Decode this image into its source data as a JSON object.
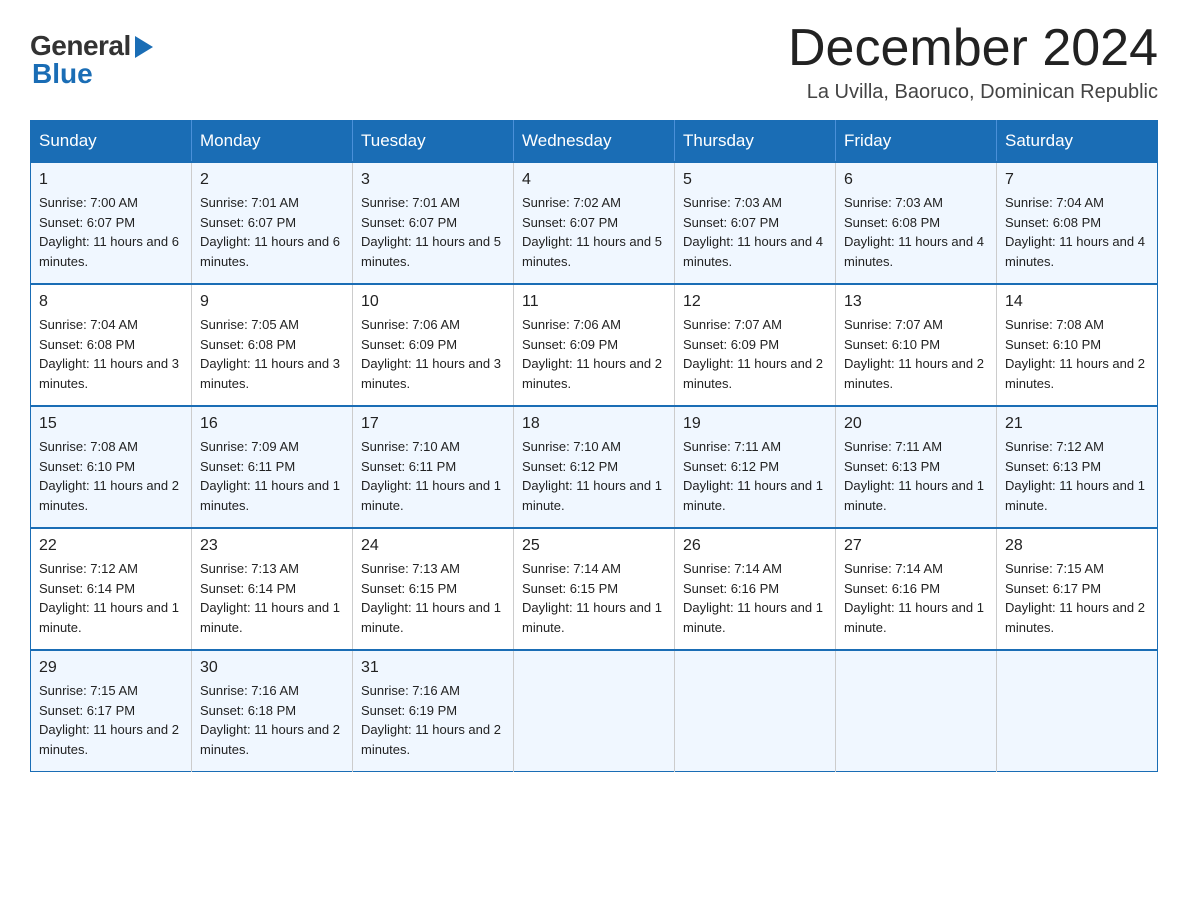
{
  "logo": {
    "general": "General",
    "blue": "Blue"
  },
  "title": "December 2024",
  "location": "La Uvilla, Baoruco, Dominican Republic",
  "days_of_week": [
    "Sunday",
    "Monday",
    "Tuesday",
    "Wednesday",
    "Thursday",
    "Friday",
    "Saturday"
  ],
  "weeks": [
    [
      {
        "day": "1",
        "sunrise": "7:00 AM",
        "sunset": "6:07 PM",
        "daylight": "11 hours and 6 minutes."
      },
      {
        "day": "2",
        "sunrise": "7:01 AM",
        "sunset": "6:07 PM",
        "daylight": "11 hours and 6 minutes."
      },
      {
        "day": "3",
        "sunrise": "7:01 AM",
        "sunset": "6:07 PM",
        "daylight": "11 hours and 5 minutes."
      },
      {
        "day": "4",
        "sunrise": "7:02 AM",
        "sunset": "6:07 PM",
        "daylight": "11 hours and 5 minutes."
      },
      {
        "day": "5",
        "sunrise": "7:03 AM",
        "sunset": "6:07 PM",
        "daylight": "11 hours and 4 minutes."
      },
      {
        "day": "6",
        "sunrise": "7:03 AM",
        "sunset": "6:08 PM",
        "daylight": "11 hours and 4 minutes."
      },
      {
        "day": "7",
        "sunrise": "7:04 AM",
        "sunset": "6:08 PM",
        "daylight": "11 hours and 4 minutes."
      }
    ],
    [
      {
        "day": "8",
        "sunrise": "7:04 AM",
        "sunset": "6:08 PM",
        "daylight": "11 hours and 3 minutes."
      },
      {
        "day": "9",
        "sunrise": "7:05 AM",
        "sunset": "6:08 PM",
        "daylight": "11 hours and 3 minutes."
      },
      {
        "day": "10",
        "sunrise": "7:06 AM",
        "sunset": "6:09 PM",
        "daylight": "11 hours and 3 minutes."
      },
      {
        "day": "11",
        "sunrise": "7:06 AM",
        "sunset": "6:09 PM",
        "daylight": "11 hours and 2 minutes."
      },
      {
        "day": "12",
        "sunrise": "7:07 AM",
        "sunset": "6:09 PM",
        "daylight": "11 hours and 2 minutes."
      },
      {
        "day": "13",
        "sunrise": "7:07 AM",
        "sunset": "6:10 PM",
        "daylight": "11 hours and 2 minutes."
      },
      {
        "day": "14",
        "sunrise": "7:08 AM",
        "sunset": "6:10 PM",
        "daylight": "11 hours and 2 minutes."
      }
    ],
    [
      {
        "day": "15",
        "sunrise": "7:08 AM",
        "sunset": "6:10 PM",
        "daylight": "11 hours and 2 minutes."
      },
      {
        "day": "16",
        "sunrise": "7:09 AM",
        "sunset": "6:11 PM",
        "daylight": "11 hours and 1 minutes."
      },
      {
        "day": "17",
        "sunrise": "7:10 AM",
        "sunset": "6:11 PM",
        "daylight": "11 hours and 1 minute."
      },
      {
        "day": "18",
        "sunrise": "7:10 AM",
        "sunset": "6:12 PM",
        "daylight": "11 hours and 1 minute."
      },
      {
        "day": "19",
        "sunrise": "7:11 AM",
        "sunset": "6:12 PM",
        "daylight": "11 hours and 1 minute."
      },
      {
        "day": "20",
        "sunrise": "7:11 AM",
        "sunset": "6:13 PM",
        "daylight": "11 hours and 1 minute."
      },
      {
        "day": "21",
        "sunrise": "7:12 AM",
        "sunset": "6:13 PM",
        "daylight": "11 hours and 1 minute."
      }
    ],
    [
      {
        "day": "22",
        "sunrise": "7:12 AM",
        "sunset": "6:14 PM",
        "daylight": "11 hours and 1 minute."
      },
      {
        "day": "23",
        "sunrise": "7:13 AM",
        "sunset": "6:14 PM",
        "daylight": "11 hours and 1 minute."
      },
      {
        "day": "24",
        "sunrise": "7:13 AM",
        "sunset": "6:15 PM",
        "daylight": "11 hours and 1 minute."
      },
      {
        "day": "25",
        "sunrise": "7:14 AM",
        "sunset": "6:15 PM",
        "daylight": "11 hours and 1 minute."
      },
      {
        "day": "26",
        "sunrise": "7:14 AM",
        "sunset": "6:16 PM",
        "daylight": "11 hours and 1 minute."
      },
      {
        "day": "27",
        "sunrise": "7:14 AM",
        "sunset": "6:16 PM",
        "daylight": "11 hours and 1 minute."
      },
      {
        "day": "28",
        "sunrise": "7:15 AM",
        "sunset": "6:17 PM",
        "daylight": "11 hours and 2 minutes."
      }
    ],
    [
      {
        "day": "29",
        "sunrise": "7:15 AM",
        "sunset": "6:17 PM",
        "daylight": "11 hours and 2 minutes."
      },
      {
        "day": "30",
        "sunrise": "7:16 AM",
        "sunset": "6:18 PM",
        "daylight": "11 hours and 2 minutes."
      },
      {
        "day": "31",
        "sunrise": "7:16 AM",
        "sunset": "6:19 PM",
        "daylight": "11 hours and 2 minutes."
      },
      null,
      null,
      null,
      null
    ]
  ]
}
